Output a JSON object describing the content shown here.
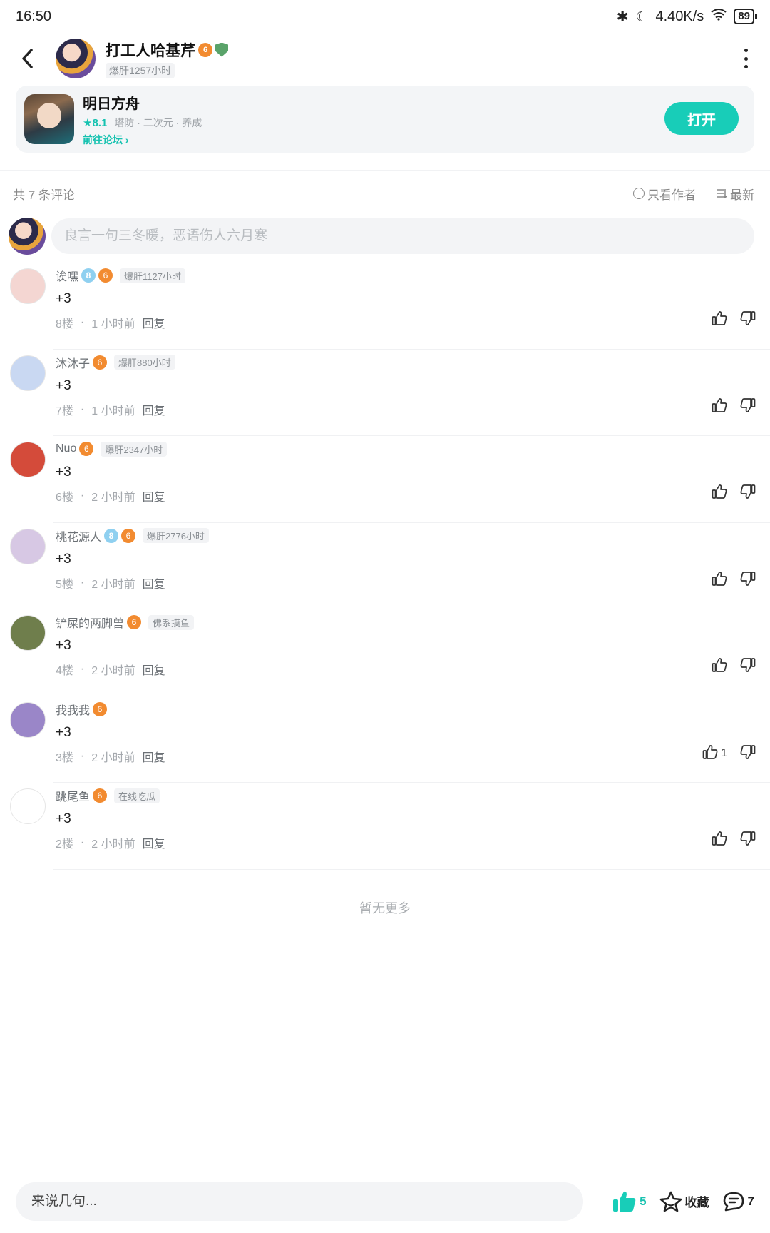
{
  "status_bar": {
    "time": "16:50",
    "net_speed": "4.40K/s",
    "battery": "89"
  },
  "header": {
    "author_name": "打工人哈基芹",
    "author_badge_text": "6",
    "author_hours": "爆肝1257小时"
  },
  "game_card": {
    "name": "明日方舟",
    "score": "★8.1",
    "tags": "塔防 · 二次元 · 养成",
    "forum_link": "前往论坛 ›",
    "open_label": "打开"
  },
  "comments_header": {
    "count_text": "共 7 条评论",
    "author_only": "只看作者",
    "sort": "最新"
  },
  "top_input": {
    "placeholder": "良言一句三冬暖，恶语伤人六月寒"
  },
  "comments": [
    {
      "name": "诶嘿",
      "level": "8",
      "tag": "爆肝1127小时",
      "text": "+3",
      "floor": "8楼",
      "time": "1 小时前",
      "reply": "回复",
      "likes": "",
      "avatar_color": "#f4d6d2"
    },
    {
      "name": "沐沐子",
      "level": "",
      "tag": "爆肝880小时",
      "text": "+3",
      "floor": "7楼",
      "time": "1 小时前",
      "reply": "回复",
      "likes": "",
      "avatar_color": "#c9d8f2"
    },
    {
      "name": "Nuo",
      "level": "",
      "tag": "爆肝2347小时",
      "text": "+3",
      "floor": "6楼",
      "time": "2 小时前",
      "reply": "回复",
      "likes": "",
      "avatar_color": "#d44b3a"
    },
    {
      "name": "桃花源人",
      "level": "8",
      "tag": "爆肝2776小时",
      "text": "+3",
      "floor": "5楼",
      "time": "2 小时前",
      "reply": "回复",
      "likes": "",
      "avatar_color": "#d7c8e4"
    },
    {
      "name": "铲屎的两脚兽",
      "level": "",
      "tag": "佛系摸鱼",
      "text": "+3",
      "floor": "4楼",
      "time": "2 小时前",
      "reply": "回复",
      "likes": "",
      "avatar_color": "#6f7e4c"
    },
    {
      "name": "我我我",
      "level": "",
      "tag": "",
      "text": "+3",
      "floor": "3楼",
      "time": "2 小时前",
      "reply": "回复",
      "likes": "1",
      "avatar_color": "#9a86c8"
    },
    {
      "name": "跳尾鱼",
      "level": "",
      "tag": "在线吃瓜",
      "text": "+3",
      "floor": "2楼",
      "time": "2 小时前",
      "reply": "回复",
      "likes": "",
      "avatar_color": "#ffffff"
    }
  ],
  "no_more": "暂无更多",
  "bottom_bar": {
    "input_placeholder": "来说几句...",
    "like_count": "5",
    "collect_label": "收藏",
    "comment_count": "7"
  },
  "colors": {
    "accent": "#18cdb8",
    "badge_orange": "#f28b30"
  }
}
